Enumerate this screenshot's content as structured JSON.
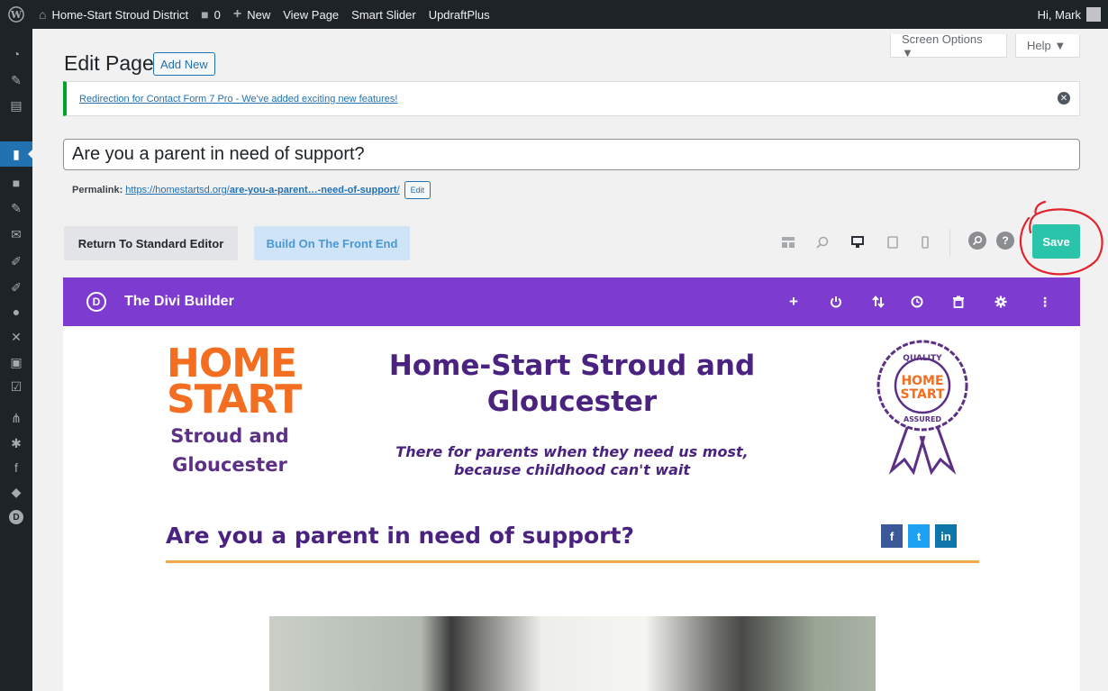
{
  "admin_bar": {
    "site_name": "Home-Start Stroud District",
    "comments_count": "0",
    "new_label": "New",
    "view_page": "View Page",
    "smart_slider": "Smart Slider",
    "updraftplus": "UpdraftPlus",
    "greeting": "Hi, Mark"
  },
  "header": {
    "title": "Edit Page",
    "add_new": "Add New",
    "screen_options": "Screen Options ▼",
    "help": "Help ▼"
  },
  "notice": {
    "text": "Redirection for Contact Form 7 Pro - We've added exciting new features!"
  },
  "post": {
    "title_value": "Are you a parent in need of support?",
    "permalink_label": "Permalink:",
    "permalink_base": "https://homestartsd.org/",
    "permalink_slug": "are-you-a-parent…-need-of-support",
    "permalink_trail": "/",
    "edit_label": "Edit"
  },
  "toolbar": {
    "standard_editor": "Return To Standard Editor",
    "front_end": "Build On The Front End",
    "save": "Save",
    "annotation_color": "#e0232d"
  },
  "divi": {
    "logo_letter": "D",
    "title": "The Divi Builder",
    "bar_color": "#7e3bd0"
  },
  "content": {
    "logo_line1": "HOME",
    "logo_line2": "START",
    "logo_sub1": "Stroud and",
    "logo_sub2": "Gloucester",
    "site_title_line1": "Home-Start Stroud and",
    "site_title_line2": "Gloucester",
    "tagline_line1": "There for parents when they need us most,",
    "tagline_line2": "because childhood can't wait",
    "badge_top": "QUALITY",
    "badge_mid1": "HOME",
    "badge_mid2": "START",
    "badge_bottom": "ASSURED",
    "page_heading": "Are you a parent in need of support?",
    "social": [
      {
        "icon": "facebook-icon",
        "glyph": "f",
        "color": "#3b5998"
      },
      {
        "icon": "twitter-icon",
        "glyph": "t",
        "color": "#1da1f2"
      },
      {
        "icon": "linkedin-icon",
        "glyph": "in",
        "color": "#0e76a8"
      }
    ]
  }
}
